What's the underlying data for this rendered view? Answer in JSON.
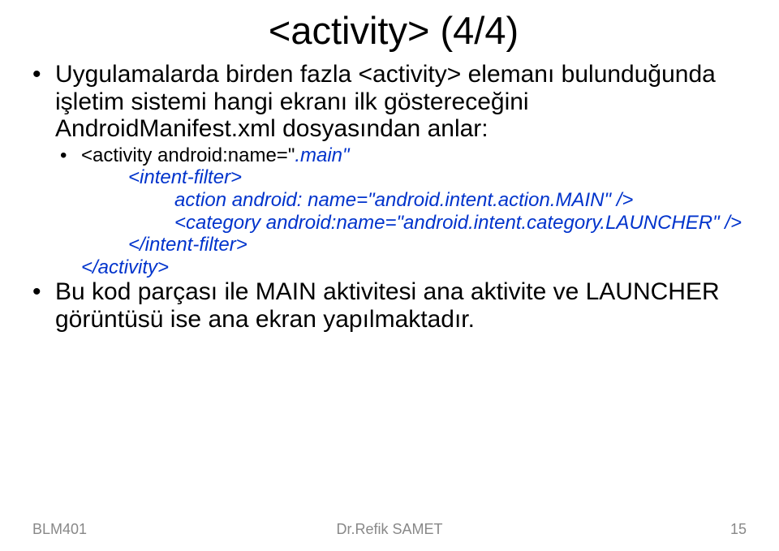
{
  "title": "<activity> (4/4)",
  "bullets": {
    "b1": "Uygulamalarda birden fazla <activity> elemanı bulunduğunda işletim sistemi hangi ekranı ilk göstereceğini AndroidManifest.xml dosyasından anlar:",
    "b2_start": "<activity android:name=\"",
    "b2_main": ".main\"",
    "code1": "<intent-filter>",
    "code2": "action android: name=\"android.intent.action.MAIN\" />",
    "code3": "<category android:name=\"android.intent.category.LAUNCHER\" />",
    "code4": "</intent-filter>",
    "code5": "</activity>",
    "b3": "Bu kod parçası ile MAIN aktivitesi ana aktivite ve LAUNCHER görüntüsü ise ana ekran yapılmaktadır."
  },
  "footer": {
    "left": "BLM401",
    "center": "Dr.Refik SAMET",
    "right": "15"
  }
}
